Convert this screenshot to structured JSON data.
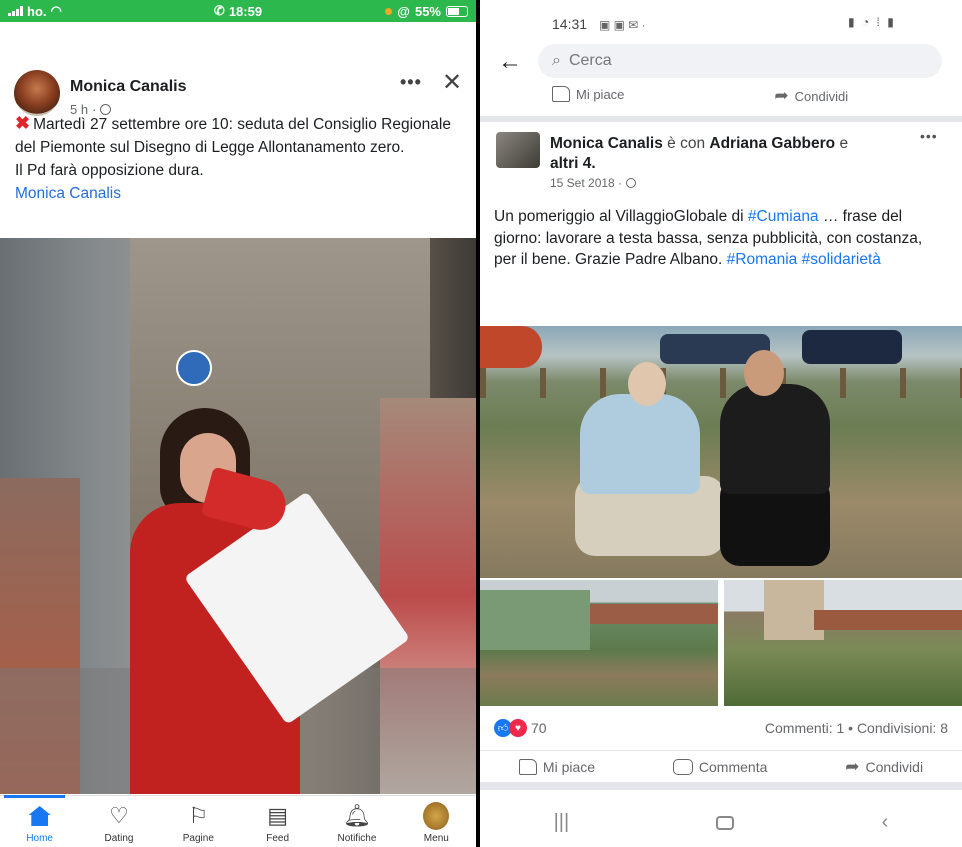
{
  "left": {
    "status": {
      "carrier": "ho.",
      "time": "18:59",
      "battery": "55%"
    },
    "post": {
      "author": "Monica Canalis",
      "time": "5 h",
      "more": "•••",
      "close": "✕",
      "text_line1": "Martedì 27 settembre ore 10: seduta del Consiglio Regionale del Piemonte sul Disegno di Legge Allontanamento zero.",
      "text_line2": "Il Pd farà opposizione dura.",
      "link": "Monica Canalis"
    },
    "tabs": [
      {
        "label": "Home",
        "icon": "home-icon"
      },
      {
        "label": "Dating",
        "icon": "heart-icon"
      },
      {
        "label": "Pagine",
        "icon": "flag-icon"
      },
      {
        "label": "Feed",
        "icon": "feed-icon"
      },
      {
        "label": "Notifiche",
        "icon": "bell-icon"
      },
      {
        "label": "Menu",
        "icon": "menu-avatar-icon"
      }
    ]
  },
  "right": {
    "status": {
      "time": "14:31"
    },
    "search": {
      "placeholder": "Cerca"
    },
    "top_actions": {
      "like": "Mi piace",
      "share": "Condividi"
    },
    "post": {
      "author": "Monica Canalis",
      "with_word": "è con",
      "tagged": "Adriana Gabbero",
      "and_word": "e",
      "others": "altri 4.",
      "date": "15 Set 2018 ·",
      "text_before": "Un pomeriggio al VillaggioGlobale di",
      "hashtag1": "#Cumiana",
      "text_after": "… frase del giorno: lavorare a testa bassa, senza pubblicità, con costanza, per il bene. Grazie Padre Albano.",
      "hashtag2": "#Romania",
      "hashtag3": "#solidarietà"
    },
    "reactions": {
      "count": "70",
      "comments": "Commenti: 1",
      "shares": "• Condivisioni: 8"
    },
    "actions": {
      "like": "Mi piace",
      "comment": "Commenta",
      "share": "Condividi"
    }
  },
  "colors": {
    "ios_green": "#2db84d",
    "fb_blue": "#1877f2",
    "red_x": "#e0242c"
  }
}
